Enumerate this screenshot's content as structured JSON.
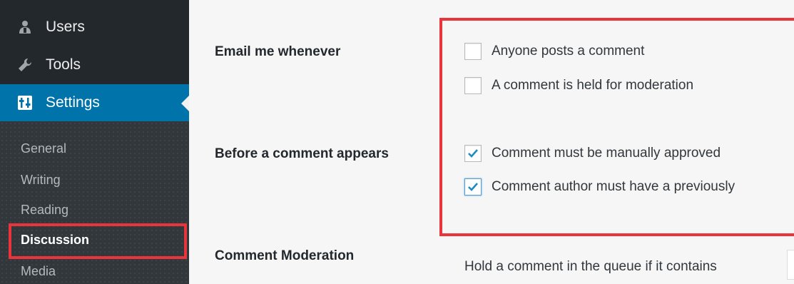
{
  "sidebar": {
    "menu": {
      "users": "Users",
      "tools": "Tools",
      "settings": "Settings"
    },
    "submenu": {
      "general": "General",
      "writing": "Writing",
      "reading": "Reading",
      "discussion": "Discussion",
      "media": "Media"
    }
  },
  "content": {
    "email_label": "Email me whenever",
    "email_options": [
      {
        "label": "Anyone posts a comment",
        "checked": false
      },
      {
        "label": "A comment is held for moderation",
        "checked": false
      }
    ],
    "before_label": "Before a comment appears",
    "before_options": [
      {
        "label": "Comment must be manually approved",
        "checked": true
      },
      {
        "label": "Comment author must have a previously",
        "checked": true
      }
    ],
    "moderation_label": "Comment Moderation",
    "moderation_text": "Hold a comment in the queue if it contains"
  },
  "colors": {
    "sidebar_bg": "#23282d",
    "active_bg": "#0073aa",
    "highlight": "#e8343a",
    "checkmark": "#1e8cbe"
  }
}
